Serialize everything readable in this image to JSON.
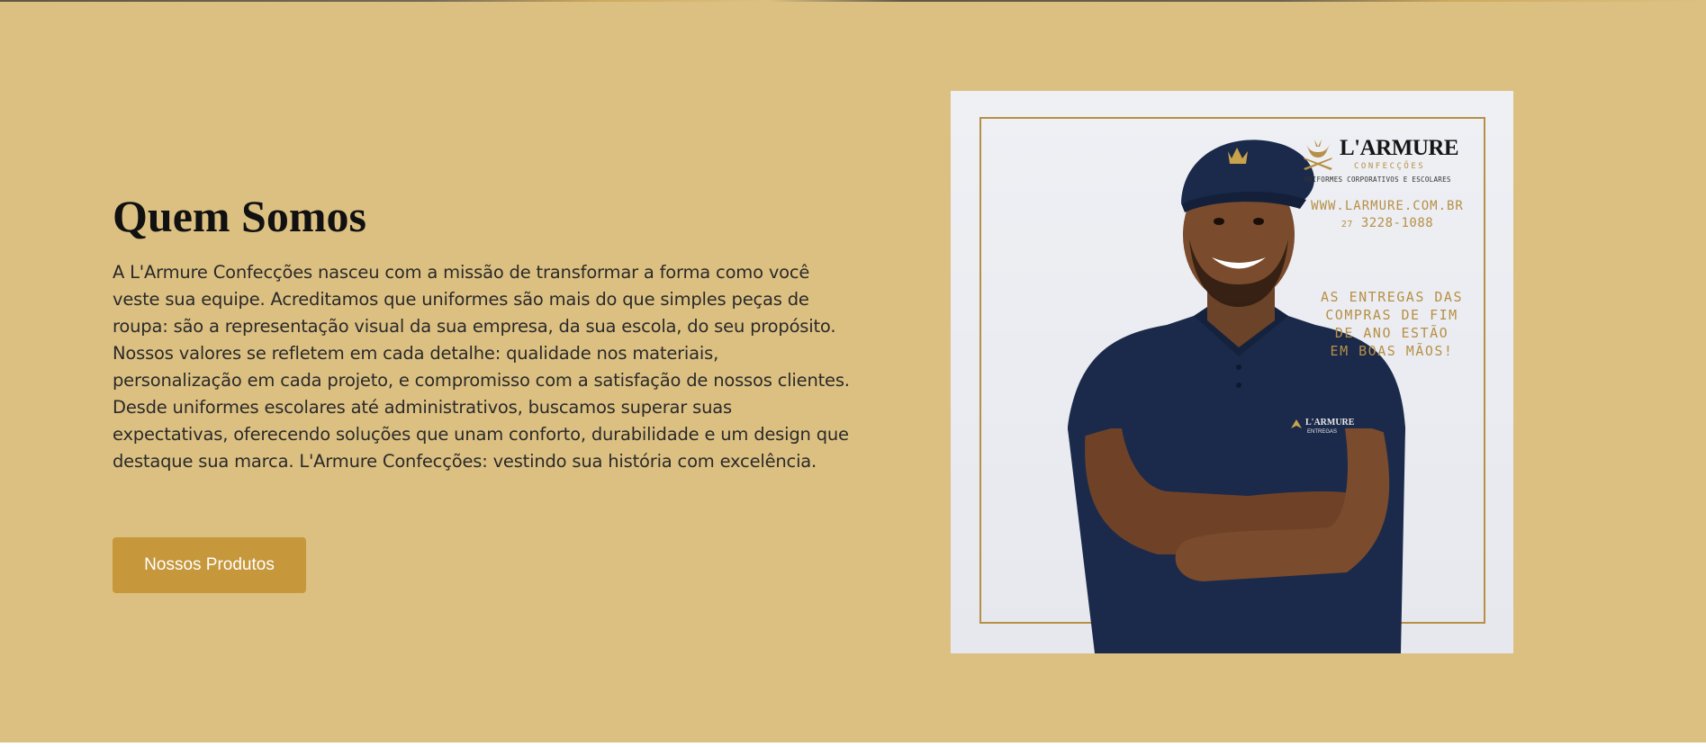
{
  "about": {
    "title": "Quem Somos",
    "body": "A L'Armure Confecções nasceu com a missão de transformar a forma como você veste sua equipe. Acreditamos que uniformes são mais do que simples peças de roupa: são a representação visual da sua empresa, da sua escola, do seu propósito. Nossos valores se refletem em cada detalhe: qualidade nos materiais, personalização em cada projeto, e compromisso com a satisfação de nossos clientes. Desde uniformes escolares até administrativos, buscamos superar suas expectativas, oferecendo soluções que unam conforto, durabilidade e um design que destaque sua marca. L'Armure Confecções: vestindo sua história com excelência.",
    "cta_label": "Nossos Produtos"
  },
  "promo": {
    "brand_name": "L'ARMURE",
    "brand_sub": "CONFECÇÕES",
    "brand_tagline": "UNIFORMES CORPORATIVOS E ESCOLARES",
    "url": "WWW.LARMURE.COM.BR",
    "phone_area": "27",
    "phone": "3228-1088",
    "headline_lines": [
      "AS ENTREGAS DAS",
      "COMPRAS DE FIM",
      "DE ANO ESTÃO",
      "EM BOAS MÃOS!"
    ],
    "shirt_brand": "L'ARMURE",
    "shirt_sub": "ENTREGAS",
    "icons": [
      "crest-logo-icon"
    ]
  },
  "colors": {
    "page_bg": "#dcc081",
    "accent_gold": "#c6973b",
    "promo_gold": "#b78f45",
    "navy": "#1b2a4a"
  }
}
